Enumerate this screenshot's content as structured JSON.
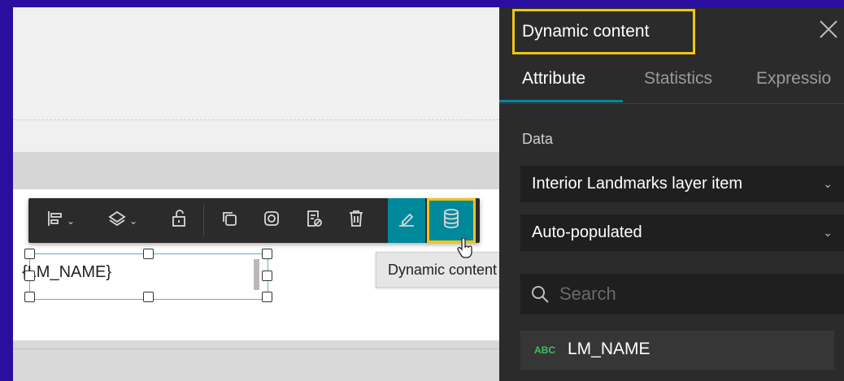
{
  "canvas": {
    "text_element": "{LM_NAME}"
  },
  "toolbar": {
    "tooltip": "Dynamic content"
  },
  "panel": {
    "title": "Dynamic content",
    "tabs": [
      {
        "label": "Attribute",
        "active": true
      },
      {
        "label": "Statistics",
        "active": false
      },
      {
        "label": "Expressio",
        "active": false
      }
    ],
    "data_label": "Data",
    "data_source": "Interior Landmarks layer item",
    "mode": "Auto-populated",
    "search_placeholder": "Search",
    "fields": [
      {
        "type_badge": "ABC",
        "name": "LM_NAME"
      }
    ]
  },
  "colors": {
    "accent": "#00889b",
    "highlight": "#f0c419",
    "panel_bg": "#2b2b2b",
    "frame": "#2a0f9e"
  },
  "icons": [
    "align-icon",
    "layers-icon",
    "unlock-icon",
    "duplicate-icon",
    "instagram-like-icon",
    "edit-document-icon",
    "trash-icon",
    "pencil-icon",
    "database-icon",
    "close-icon",
    "search-icon"
  ]
}
